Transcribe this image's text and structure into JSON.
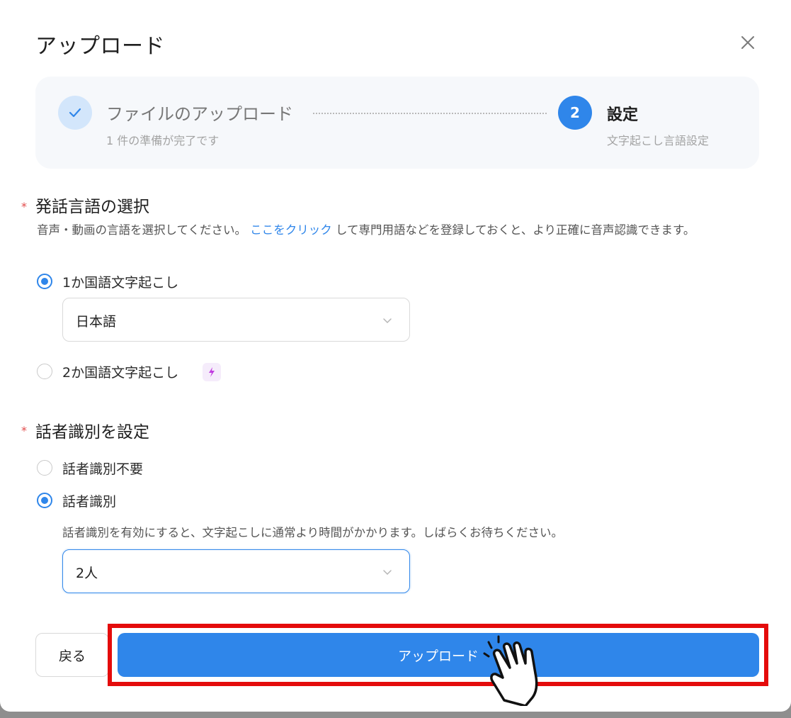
{
  "dialog": {
    "title": "アップロード",
    "close_icon": "close-icon"
  },
  "steps": {
    "step1": {
      "title": "ファイルのアップロード",
      "subtitle": "1 件の準備が完了です",
      "status_icon": "check-icon"
    },
    "step2": {
      "number": "2",
      "title": "設定",
      "subtitle": "文字起こし言語設定"
    }
  },
  "language": {
    "required_mark": "*",
    "title": "発話言語の選択",
    "desc_before": "音声・動画の言語を選択してください。",
    "desc_link": "ここをクリック",
    "desc_after": "して専門用語などを登録しておくと、より正確に音声認識できます。",
    "option1_label": "1か国語文字起こし",
    "option1_selected": true,
    "select_value": "日本語",
    "option2_label": "2か国語文字起こし",
    "option2_selected": false,
    "option2_badge_icon": "ai-sparkle-icon"
  },
  "speaker": {
    "required_mark": "*",
    "title": "話者識別を設定",
    "option1_label": "話者識別不要",
    "option1_selected": false,
    "option2_label": "話者識別",
    "option2_selected": true,
    "note": "話者識別を有効にすると、文字起こしに通常より時間がかかります。しばらくお待ちください。",
    "select_value": "2人"
  },
  "footer": {
    "back_label": "戻る",
    "upload_label": "アップロード",
    "pointer_icon": "hand-pointer-icon"
  },
  "colors": {
    "accent": "#2f86ea",
    "highlight": "#e40b0b",
    "required": "#e24b4b"
  }
}
